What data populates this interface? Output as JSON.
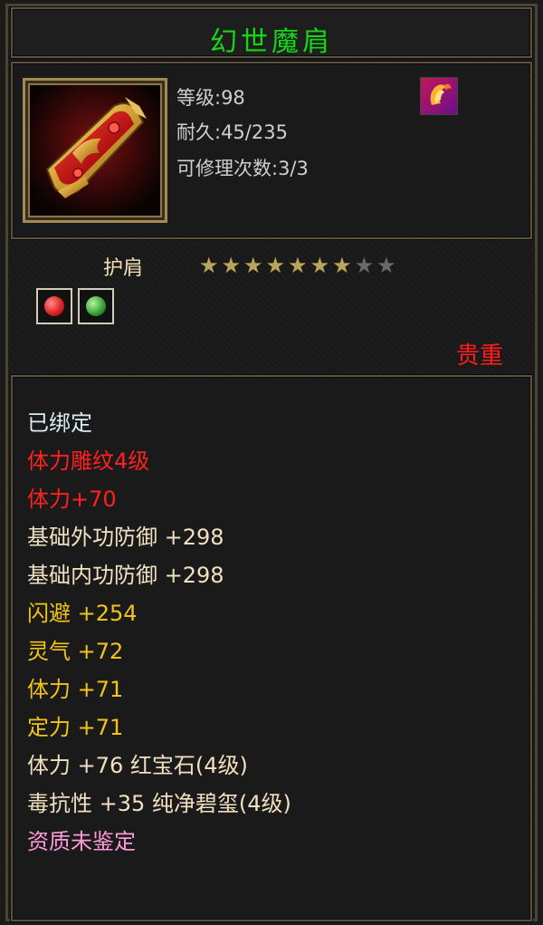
{
  "item": {
    "name": "幻世魔肩",
    "level": "等级:98",
    "durability": "耐久:45/235",
    "repairs": "可修理次数:3/3",
    "icon": "red-gold-shoulder-guard",
    "class_icon": "fire-horseshoe-icon",
    "type": "护肩",
    "stars": {
      "filled": 7,
      "total": 9
    },
    "gems": [
      {
        "icon": "red-gem-icon",
        "color": "#e02424"
      },
      {
        "icon": "green-gem-icon",
        "color": "#3aa83a"
      }
    ],
    "quality": "贵重"
  },
  "properties": [
    {
      "text": "已绑定",
      "color": "#d8ecf4"
    },
    {
      "text": "体力雕纹4级",
      "color": "#ff2020"
    },
    {
      "text": "体力+70",
      "color": "#ff2020"
    },
    {
      "text": "基础外功防御 +298",
      "color": "#f0e0c0"
    },
    {
      "text": "基础内功防御 +298",
      "color": "#f0e0c0"
    },
    {
      "text": "闪避 +254",
      "color": "#f0c419"
    },
    {
      "text": "灵气 +72",
      "color": "#f0c419"
    },
    {
      "text": "体力 +71",
      "color": "#f0c419"
    },
    {
      "text": "定力 +71",
      "color": "#f0c419"
    },
    {
      "text": "体力 +76 红宝石(4级)",
      "color": "#f0e0c0"
    },
    {
      "text": "毒抗性 +35 纯净碧玺(4级)",
      "color": "#f0e0c0"
    },
    {
      "text": "资质未鉴定",
      "color": "#ff9ad8"
    }
  ],
  "colors": {
    "title": "#1fd11f",
    "quality": "#ff1d1d",
    "border": "#5a523e"
  }
}
